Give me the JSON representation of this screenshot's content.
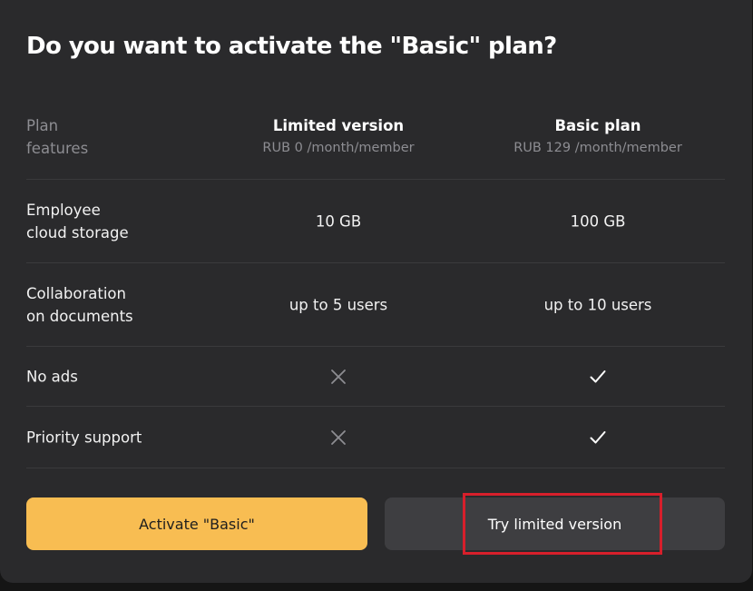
{
  "dialog": {
    "title": "Do you want to activate the \"Basic\" plan?"
  },
  "table": {
    "header": {
      "feature_label": "Plan\nfeatures",
      "plans": [
        {
          "name": "Limited version",
          "price": "RUB 0 /month/member"
        },
        {
          "name": "Basic plan",
          "price": "RUB 129 /month/member"
        }
      ]
    },
    "rows": [
      {
        "feature": "Employee\ncloud storage",
        "limited": "10 GB",
        "basic": "100 GB"
      },
      {
        "feature": "Collaboration\non documents",
        "limited": "up to 5 users",
        "basic": "up to 10 users"
      },
      {
        "feature": "No ads",
        "limited_icon": "cross-icon",
        "basic_icon": "check-icon"
      },
      {
        "feature": "Priority support",
        "limited_icon": "cross-icon",
        "basic_icon": "check-icon"
      }
    ]
  },
  "actions": {
    "primary_label": "Activate \"Basic\"",
    "secondary_label": "Try limited version"
  },
  "colors": {
    "modal_background": "#2a2a2c",
    "accent": "#f8bd52",
    "secondary_button": "#3e3e41",
    "highlight_border": "#d71f2b"
  }
}
